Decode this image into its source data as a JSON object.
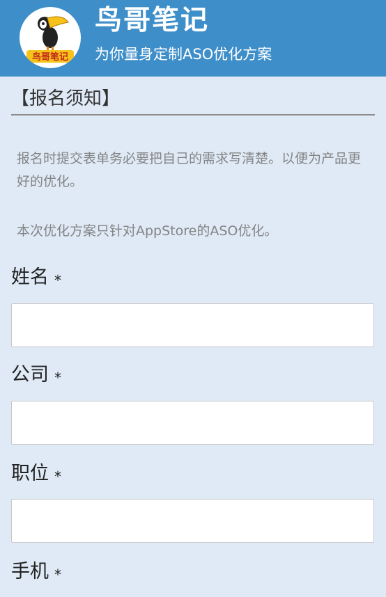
{
  "header": {
    "title": "鸟哥笔记",
    "subtitle": "为你量身定制ASO优化方案",
    "logo_text": "鸟哥笔记",
    "colors": {
      "bar": "#3d8ec9",
      "logo_bg": "#ffffff",
      "toucan_beak": "#f7c21a"
    }
  },
  "notice": {
    "heading": "【报名须知】",
    "paragraphs": [
      "报名时提交表单务必要把自己的需求写清楚。以便为产品更好的优化。",
      "本次优化方案只针对AppStore的ASO优化。"
    ]
  },
  "form": {
    "required_mark": "*",
    "fields": [
      {
        "label": "姓名",
        "value": ""
      },
      {
        "label": "公司",
        "value": ""
      },
      {
        "label": "职位",
        "value": ""
      },
      {
        "label": "手机",
        "value": ""
      }
    ]
  }
}
